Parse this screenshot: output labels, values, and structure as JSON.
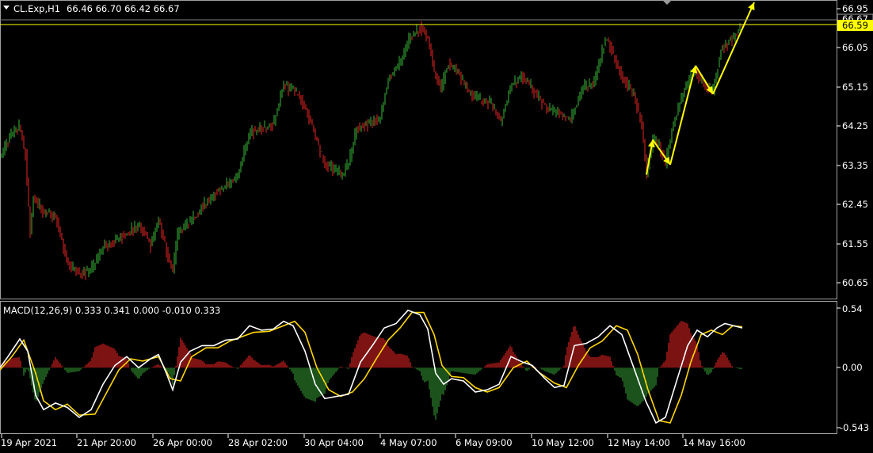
{
  "header": {
    "symbol_label": "CL.Exp,H1",
    "ohlc": "66.46 66.70 66.42 66.67"
  },
  "indicator": {
    "label": "MACD(12,26,9) 0.333 0.341 0.000 -0.010 0.333"
  },
  "colors": {
    "background": "#000000",
    "bull_candle": "#2f9a2f",
    "bear_candle": "#c0201e",
    "macd_line": "#ffffff",
    "signal_line": "#ffd700",
    "hist_positive": "#d02020",
    "hist_negative": "#2e8b2e",
    "grid": "#a0a0a0",
    "price_tag_bg": "#ffff00",
    "arrow": "#ffff00"
  },
  "price_axis": {
    "ticks": [
      "66.95",
      "66.05",
      "65.15",
      "64.25",
      "63.35",
      "62.45",
      "61.55",
      "60.65"
    ],
    "ask_tag": "66.67",
    "bid_tag": "66.59"
  },
  "macd_axis": {
    "ticks": [
      "0.54",
      "0.00",
      "-0.543"
    ]
  },
  "time_axis": {
    "ticks": [
      "19 Apr 2021",
      "21 Apr 20:00",
      "26 Apr 00:00",
      "28 Apr 02:00",
      "30 Apr 04:00",
      "4 May 07:00",
      "6 May 09:00",
      "10 May 12:00",
      "12 May 14:00",
      "14 May 16:00"
    ]
  },
  "chart_data": {
    "type": "candlestick",
    "symbol": "CL.Exp",
    "timeframe": "H1",
    "ylim": [
      60.3,
      67.0
    ],
    "price_path": [
      [
        0,
        63.45
      ],
      [
        12,
        63.9
      ],
      [
        25,
        64.15
      ],
      [
        32,
        63.5
      ],
      [
        38,
        61.7
      ],
      [
        42,
        62.5
      ],
      [
        55,
        62.2
      ],
      [
        70,
        62.1
      ],
      [
        85,
        61.0
      ],
      [
        100,
        60.8
      ],
      [
        115,
        60.85
      ],
      [
        130,
        61.4
      ],
      [
        145,
        61.55
      ],
      [
        160,
        61.7
      ],
      [
        175,
        61.9
      ],
      [
        190,
        61.45
      ],
      [
        200,
        62.0
      ],
      [
        210,
        61.3
      ],
      [
        218,
        60.85
      ],
      [
        225,
        61.8
      ],
      [
        240,
        61.95
      ],
      [
        255,
        62.3
      ],
      [
        270,
        62.6
      ],
      [
        285,
        62.8
      ],
      [
        300,
        63.0
      ],
      [
        315,
        64.0
      ],
      [
        330,
        64.1
      ],
      [
        345,
        64.2
      ],
      [
        358,
        65.1
      ],
      [
        370,
        65.0
      ],
      [
        385,
        64.6
      ],
      [
        398,
        63.9
      ],
      [
        410,
        63.3
      ],
      [
        420,
        63.2
      ],
      [
        432,
        63.05
      ],
      [
        440,
        63.3
      ],
      [
        450,
        64.1
      ],
      [
        465,
        64.2
      ],
      [
        480,
        64.35
      ],
      [
        490,
        65.3
      ],
      [
        505,
        65.6
      ],
      [
        515,
        66.1
      ],
      [
        530,
        66.45
      ],
      [
        540,
        66.2
      ],
      [
        548,
        65.4
      ],
      [
        556,
        65.0
      ],
      [
        566,
        65.6
      ],
      [
        578,
        65.4
      ],
      [
        590,
        65.0
      ],
      [
        605,
        64.75
      ],
      [
        618,
        64.7
      ],
      [
        632,
        64.3
      ],
      [
        645,
        65.1
      ],
      [
        660,
        65.3
      ],
      [
        672,
        65.0
      ],
      [
        688,
        64.6
      ],
      [
        700,
        64.5
      ],
      [
        712,
        64.4
      ],
      [
        720,
        64.3
      ],
      [
        735,
        65.0
      ],
      [
        750,
        65.2
      ],
      [
        765,
        66.2
      ],
      [
        772,
        65.9
      ],
      [
        785,
        65.3
      ],
      [
        800,
        64.9
      ],
      [
        810,
        64.2
      ],
      [
        816,
        63.05
      ],
      [
        824,
        63.85
      ],
      [
        832,
        63.7
      ],
      [
        840,
        63.3
      ],
      [
        848,
        64.1
      ],
      [
        860,
        64.8
      ],
      [
        875,
        65.45
      ],
      [
        885,
        65.2
      ],
      [
        895,
        65.0
      ],
      [
        900,
        65.0
      ],
      [
        910,
        65.9
      ],
      [
        925,
        66.2
      ],
      [
        937,
        66.55
      ]
    ],
    "arrows": [
      {
        "from": [
          816,
          63.05
        ],
        "to": [
          824,
          63.85
        ]
      },
      {
        "from": [
          824,
          63.85
        ],
        "to": [
          846,
          63.28
        ]
      },
      {
        "from": [
          846,
          63.28
        ],
        "to": [
          878,
          65.55
        ]
      },
      {
        "from": [
          878,
          65.55
        ],
        "to": [
          900,
          64.9
        ]
      },
      {
        "from": [
          900,
          64.9
        ],
        "to": [
          952,
          67.0
        ]
      }
    ],
    "macd": {
      "ylim": [
        -0.543,
        0.54
      ],
      "macd_path": [
        [
          0,
          0.0
        ],
        [
          10,
          0.1
        ],
        [
          25,
          0.26
        ],
        [
          35,
          0.15
        ],
        [
          45,
          -0.25
        ],
        [
          55,
          -0.38
        ],
        [
          70,
          -0.32
        ],
        [
          85,
          -0.36
        ],
        [
          100,
          -0.45
        ],
        [
          115,
          -0.38
        ],
        [
          130,
          -0.15
        ],
        [
          145,
          0.02
        ],
        [
          160,
          0.1
        ],
        [
          175,
          0.0
        ],
        [
          190,
          0.08
        ],
        [
          200,
          0.12
        ],
        [
          210,
          -0.05
        ],
        [
          218,
          -0.2
        ],
        [
          228,
          0.05
        ],
        [
          240,
          0.15
        ],
        [
          255,
          0.2
        ],
        [
          270,
          0.2
        ],
        [
          285,
          0.25
        ],
        [
          300,
          0.26
        ],
        [
          315,
          0.38
        ],
        [
          330,
          0.34
        ],
        [
          345,
          0.35
        ],
        [
          358,
          0.42
        ],
        [
          370,
          0.38
        ],
        [
          385,
          0.15
        ],
        [
          398,
          -0.15
        ],
        [
          410,
          -0.28
        ],
        [
          425,
          -0.26
        ],
        [
          440,
          -0.24
        ],
        [
          455,
          0.05
        ],
        [
          470,
          0.2
        ],
        [
          485,
          0.36
        ],
        [
          500,
          0.4
        ],
        [
          515,
          0.52
        ],
        [
          530,
          0.48
        ],
        [
          540,
          0.35
        ],
        [
          550,
          -0.05
        ],
        [
          560,
          -0.15
        ],
        [
          570,
          -0.1
        ],
        [
          585,
          -0.12
        ],
        [
          600,
          -0.22
        ],
        [
          615,
          -0.2
        ],
        [
          630,
          -0.15
        ],
        [
          645,
          0.1
        ],
        [
          660,
          0.05
        ],
        [
          672,
          0.02
        ],
        [
          688,
          -0.1
        ],
        [
          700,
          -0.18
        ],
        [
          712,
          -0.16
        ],
        [
          725,
          0.2
        ],
        [
          740,
          0.22
        ],
        [
          755,
          0.28
        ],
        [
          770,
          0.38
        ],
        [
          785,
          0.3
        ],
        [
          800,
          0.0
        ],
        [
          815,
          -0.3
        ],
        [
          828,
          -0.5
        ],
        [
          840,
          -0.45
        ],
        [
          855,
          -0.1
        ],
        [
          868,
          0.2
        ],
        [
          880,
          0.34
        ],
        [
          893,
          0.28
        ],
        [
          905,
          0.36
        ],
        [
          915,
          0.4
        ],
        [
          937,
          0.36
        ]
      ],
      "signal_path": [
        [
          0,
          -0.02
        ],
        [
          15,
          0.1
        ],
        [
          30,
          0.25
        ],
        [
          45,
          -0.05
        ],
        [
          55,
          -0.3
        ],
        [
          70,
          -0.38
        ],
        [
          85,
          -0.33
        ],
        [
          100,
          -0.43
        ],
        [
          120,
          -0.42
        ],
        [
          135,
          -0.22
        ],
        [
          150,
          -0.02
        ],
        [
          165,
          0.08
        ],
        [
          180,
          0.06
        ],
        [
          200,
          0.1
        ],
        [
          215,
          -0.1
        ],
        [
          228,
          -0.12
        ],
        [
          242,
          0.1
        ],
        [
          260,
          0.18
        ],
        [
          275,
          0.18
        ],
        [
          290,
          0.24
        ],
        [
          305,
          0.28
        ],
        [
          320,
          0.32
        ],
        [
          340,
          0.33
        ],
        [
          358,
          0.38
        ],
        [
          372,
          0.42
        ],
        [
          385,
          0.32
        ],
        [
          400,
          0.0
        ],
        [
          415,
          -0.2
        ],
        [
          430,
          -0.26
        ],
        [
          445,
          -0.22
        ],
        [
          460,
          -0.1
        ],
        [
          475,
          0.08
        ],
        [
          490,
          0.25
        ],
        [
          505,
          0.36
        ],
        [
          520,
          0.5
        ],
        [
          535,
          0.5
        ],
        [
          548,
          0.3
        ],
        [
          558,
          0.02
        ],
        [
          570,
          -0.08
        ],
        [
          585,
          -0.09
        ],
        [
          600,
          -0.18
        ],
        [
          615,
          -0.22
        ],
        [
          630,
          -0.18
        ],
        [
          648,
          0.0
        ],
        [
          665,
          0.06
        ],
        [
          680,
          -0.04
        ],
        [
          700,
          -0.14
        ],
        [
          715,
          -0.18
        ],
        [
          730,
          0.02
        ],
        [
          745,
          0.18
        ],
        [
          760,
          0.24
        ],
        [
          778,
          0.38
        ],
        [
          792,
          0.34
        ],
        [
          805,
          0.12
        ],
        [
          818,
          -0.2
        ],
        [
          832,
          -0.48
        ],
        [
          846,
          -0.5
        ],
        [
          860,
          -0.25
        ],
        [
          872,
          0.05
        ],
        [
          885,
          0.3
        ],
        [
          898,
          0.34
        ],
        [
          912,
          0.3
        ],
        [
          925,
          0.38
        ],
        [
          937,
          0.37
        ]
      ]
    }
  }
}
